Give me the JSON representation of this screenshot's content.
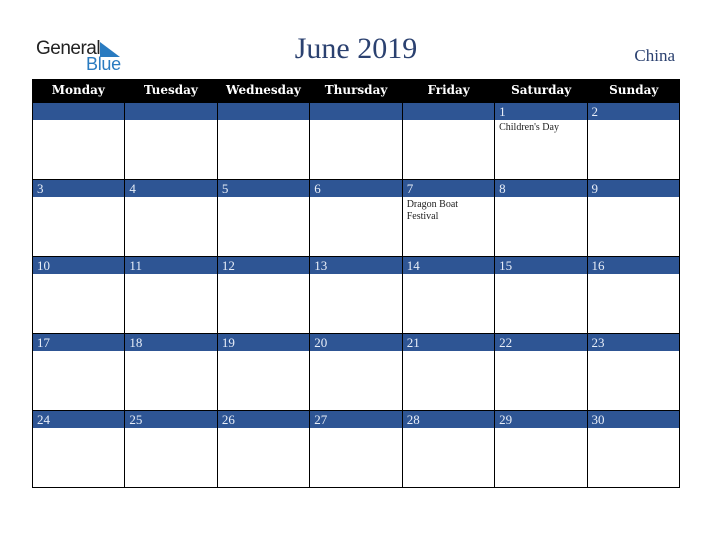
{
  "logo": {
    "line1": "General",
    "line2": "Blue"
  },
  "header": {
    "title": "June 2019",
    "country": "China"
  },
  "colors": {
    "band": "#2e5594",
    "title": "#2b4170",
    "logo_blue": "#2a7bc0"
  },
  "weekdays": [
    "Monday",
    "Tuesday",
    "Wednesday",
    "Thursday",
    "Friday",
    "Saturday",
    "Sunday"
  ],
  "weeks": [
    [
      {
        "day": "",
        "event": ""
      },
      {
        "day": "",
        "event": ""
      },
      {
        "day": "",
        "event": ""
      },
      {
        "day": "",
        "event": ""
      },
      {
        "day": "",
        "event": ""
      },
      {
        "day": "1",
        "event": "Children's Day"
      },
      {
        "day": "2",
        "event": ""
      }
    ],
    [
      {
        "day": "3",
        "event": ""
      },
      {
        "day": "4",
        "event": ""
      },
      {
        "day": "5",
        "event": ""
      },
      {
        "day": "6",
        "event": ""
      },
      {
        "day": "7",
        "event": "Dragon Boat Festival"
      },
      {
        "day": "8",
        "event": ""
      },
      {
        "day": "9",
        "event": ""
      }
    ],
    [
      {
        "day": "10",
        "event": ""
      },
      {
        "day": "11",
        "event": ""
      },
      {
        "day": "12",
        "event": ""
      },
      {
        "day": "13",
        "event": ""
      },
      {
        "day": "14",
        "event": ""
      },
      {
        "day": "15",
        "event": ""
      },
      {
        "day": "16",
        "event": ""
      }
    ],
    [
      {
        "day": "17",
        "event": ""
      },
      {
        "day": "18",
        "event": ""
      },
      {
        "day": "19",
        "event": ""
      },
      {
        "day": "20",
        "event": ""
      },
      {
        "day": "21",
        "event": ""
      },
      {
        "day": "22",
        "event": ""
      },
      {
        "day": "23",
        "event": ""
      }
    ],
    [
      {
        "day": "24",
        "event": ""
      },
      {
        "day": "25",
        "event": ""
      },
      {
        "day": "26",
        "event": ""
      },
      {
        "day": "27",
        "event": ""
      },
      {
        "day": "28",
        "event": ""
      },
      {
        "day": "29",
        "event": ""
      },
      {
        "day": "30",
        "event": ""
      }
    ]
  ]
}
